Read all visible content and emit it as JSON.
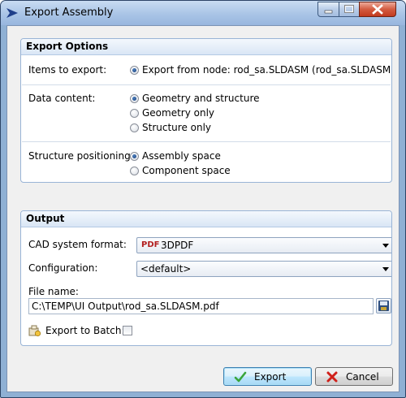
{
  "window": {
    "title": "Export Assembly"
  },
  "export_options": {
    "header": "Export Options",
    "items_label": "Items to export:",
    "items_option": "Export from node: rod_sa.SLDASM (rod_sa.SLDASM)",
    "data_content_label": "Data content:",
    "data_content_options": [
      "Geometry and structure",
      "Geometry only",
      "Structure only"
    ],
    "data_content_selected": 0,
    "positioning_label": "Structure positioning:",
    "positioning_options": [
      "Assembly space",
      "Component space"
    ],
    "positioning_selected": 0
  },
  "output": {
    "header": "Output",
    "cad_format_label": "CAD system format:",
    "cad_format_icon_text": "PDF",
    "cad_format_value": "3DPDF",
    "configuration_label": "Configuration:",
    "configuration_value": "<default>",
    "file_name_label": "File name:",
    "file_name_value": "C:\\TEMP\\UI Output\\rod_sa.SLDASM.pdf",
    "export_to_batch_label": "Export to Batch:",
    "export_to_batch_checked": false
  },
  "buttons": {
    "export": "Export",
    "cancel": "Cancel"
  },
  "colors": {
    "accent": "#3c7fb1",
    "check": "#3aa53a",
    "cancel_x": "#d0201a"
  }
}
